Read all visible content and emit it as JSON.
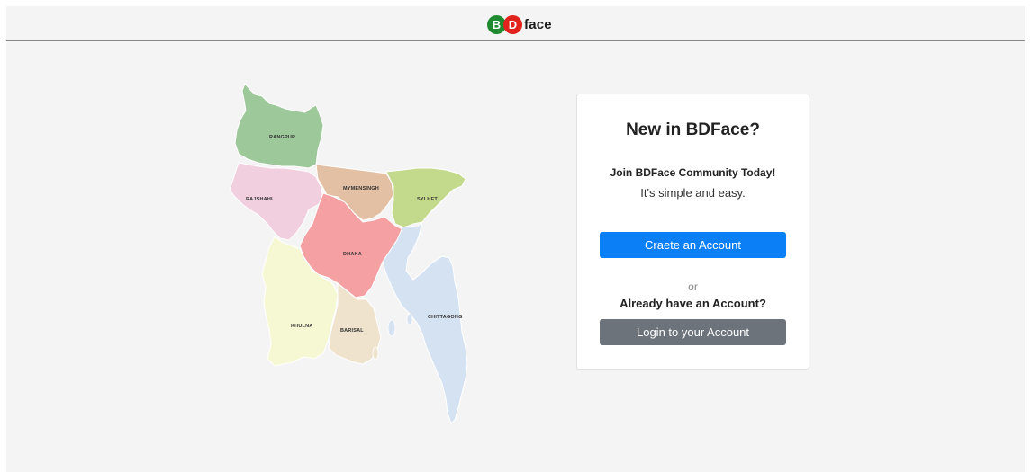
{
  "header": {
    "logo_b": "B",
    "logo_d": "D",
    "logo_text": "face"
  },
  "map": {
    "regions": [
      {
        "name": "RANGPUR",
        "color": "#9dc89a"
      },
      {
        "name": "RAJSHAHI",
        "color": "#f1cfdf"
      },
      {
        "name": "MYMENSINGH",
        "color": "#e3bfa3"
      },
      {
        "name": "SYLHET",
        "color": "#c3d98b"
      },
      {
        "name": "DHAKA",
        "color": "#f5a1a4"
      },
      {
        "name": "KHULNA",
        "color": "#f6f8d3"
      },
      {
        "name": "BARISAL",
        "color": "#efe3cd"
      },
      {
        "name": "CHITTAGONG",
        "color": "#d5e2f2"
      }
    ]
  },
  "card": {
    "title": "New in BDFace?",
    "subtitle": "Join BDFace Community Today!",
    "tagline": "It's simple and easy.",
    "create_label": "Craete an Account",
    "or_label": "or",
    "already_label": "Already have an Account?",
    "login_label": "Login to your Account"
  },
  "colors": {
    "primary": "#0b7ff5",
    "secondary": "#6c737a",
    "logo_green": "#1f8a2f",
    "logo_red": "#e0231c"
  }
}
